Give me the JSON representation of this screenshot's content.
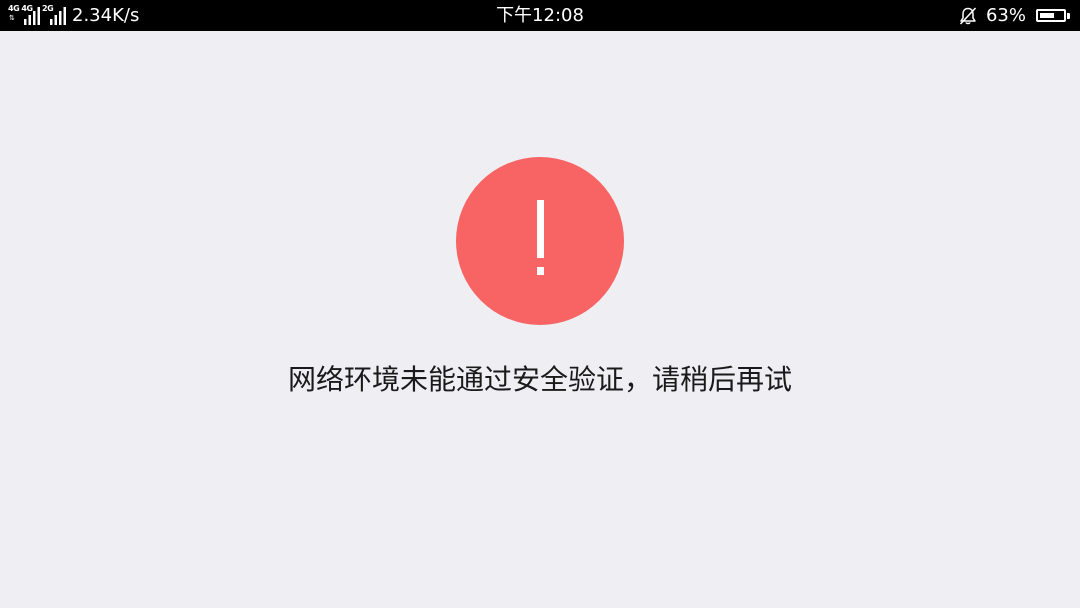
{
  "status_bar": {
    "signal_1_tag": "4G 4G",
    "signal_2_tag": "2G",
    "network_speed": "2.34K/s",
    "time": "下午12:08",
    "battery_percent": "63%",
    "battery_level": 0.63,
    "background_color": "#000000",
    "text_color": "#ffffff"
  },
  "alert": {
    "icon": "exclamation-icon",
    "circle_color": "#f86464",
    "message": "网络环境未能通过安全验证，请稍后再试"
  },
  "page": {
    "background_color": "#efeef3"
  }
}
